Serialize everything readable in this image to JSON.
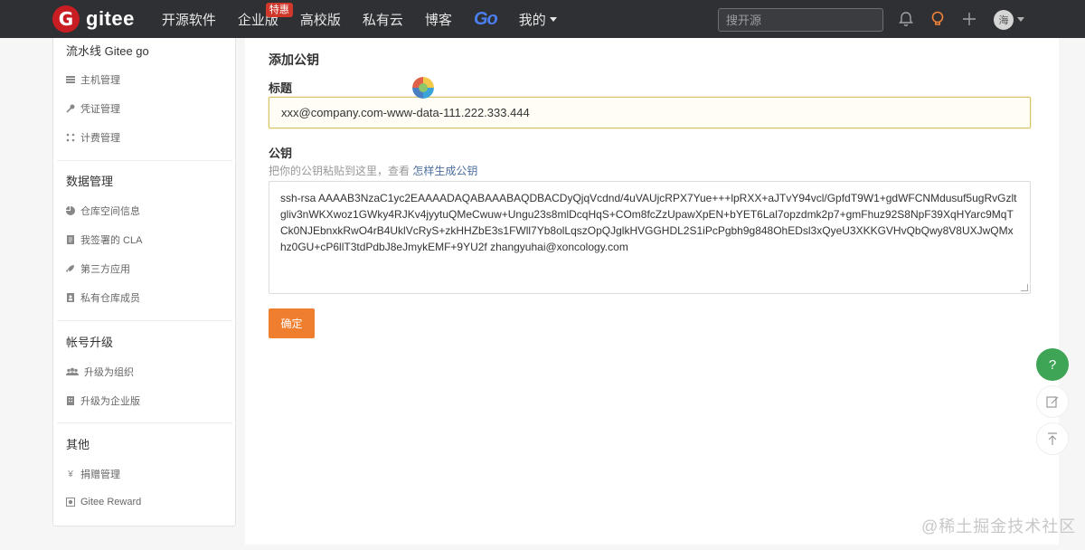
{
  "nav": {
    "logo_text": "gitee",
    "logo_mark": "G",
    "items": [
      {
        "label": "开源软件"
      },
      {
        "label": "企业版",
        "badge": "特惠"
      },
      {
        "label": "高校版"
      },
      {
        "label": "私有云"
      },
      {
        "label": "博客"
      },
      {
        "label": "Go"
      },
      {
        "label": "我的"
      }
    ],
    "search_placeholder": "搜开源",
    "avatar_text": "海",
    "icons": [
      "bell-icon",
      "lightbulb-icon",
      "plus-icon"
    ]
  },
  "sidebar": {
    "pipeline_label": "流水线 Gitee go",
    "pipeline_items": [
      {
        "label": "主机管理",
        "icon": "server-icon"
      },
      {
        "label": "凭证管理",
        "icon": "key-icon"
      },
      {
        "label": "计费管理",
        "icon": "billing-icon"
      }
    ],
    "data_section": "数据管理",
    "data_items": [
      {
        "label": "仓库空间信息",
        "icon": "pie-icon"
      },
      {
        "label": "我签署的 CLA",
        "icon": "document-icon"
      },
      {
        "label": "第三方应用",
        "icon": "rocket-icon"
      },
      {
        "label": "私有仓库成员",
        "icon": "member-icon"
      }
    ],
    "upgrade_section": "帐号升级",
    "upgrade_items": [
      {
        "label": "升级为组织",
        "icon": "group-icon"
      },
      {
        "label": "升级为企业版",
        "icon": "building-icon"
      }
    ],
    "other_section": "其他",
    "other_items": [
      {
        "label": "捐赠管理",
        "icon": "yen-icon"
      },
      {
        "label": "Gitee Reward",
        "icon": "reward-icon"
      }
    ]
  },
  "form": {
    "heading": "添加公钥",
    "title_label": "标题",
    "title_value": "xxx@company.com-www-data-111.222.333.444",
    "key_label": "公钥",
    "hint_text": "把你的公钥粘贴到这里，查看 ",
    "hint_link": "怎样生成公钥",
    "key_value": "ssh-rsa AAAAB3NzaC1yc2EAAAADAQABAAABAQDBACDyQjqVcdnd/4uVAUjcRPX7Yue+++lpRXX+aJTvY94vcl/GpfdT9W1+gdWFCNMdusuf5ugRvGzltgliv3nWKXwoz1GWky4RJKv4jyytuQMeCwuw+Ungu23s8mlDcqHqS+COm8fcZzUpawXpEN+bYET6Lal7opzdmk2p7+gmFhuz92S8NpF39XqHYarc9MqTCk0NJEbnxkRwO4rB4UklVcRyS+zkHHZbE3s1FWll7Yb8olLqszOpQJglkHVGGHDL2S1iPcPgbh9g848OhEDsl3xQyeU3XKKGVHvQbQwy8V8UXJwQMxhz0GU+cP6llT3tdPdbJ8eJmykEMF+9YU2f zhangyuhai@xoncology.com",
    "confirm_label": "确定"
  },
  "floating": {
    "help_label": "?"
  },
  "watermark": "@稀土掘金技术社区"
}
